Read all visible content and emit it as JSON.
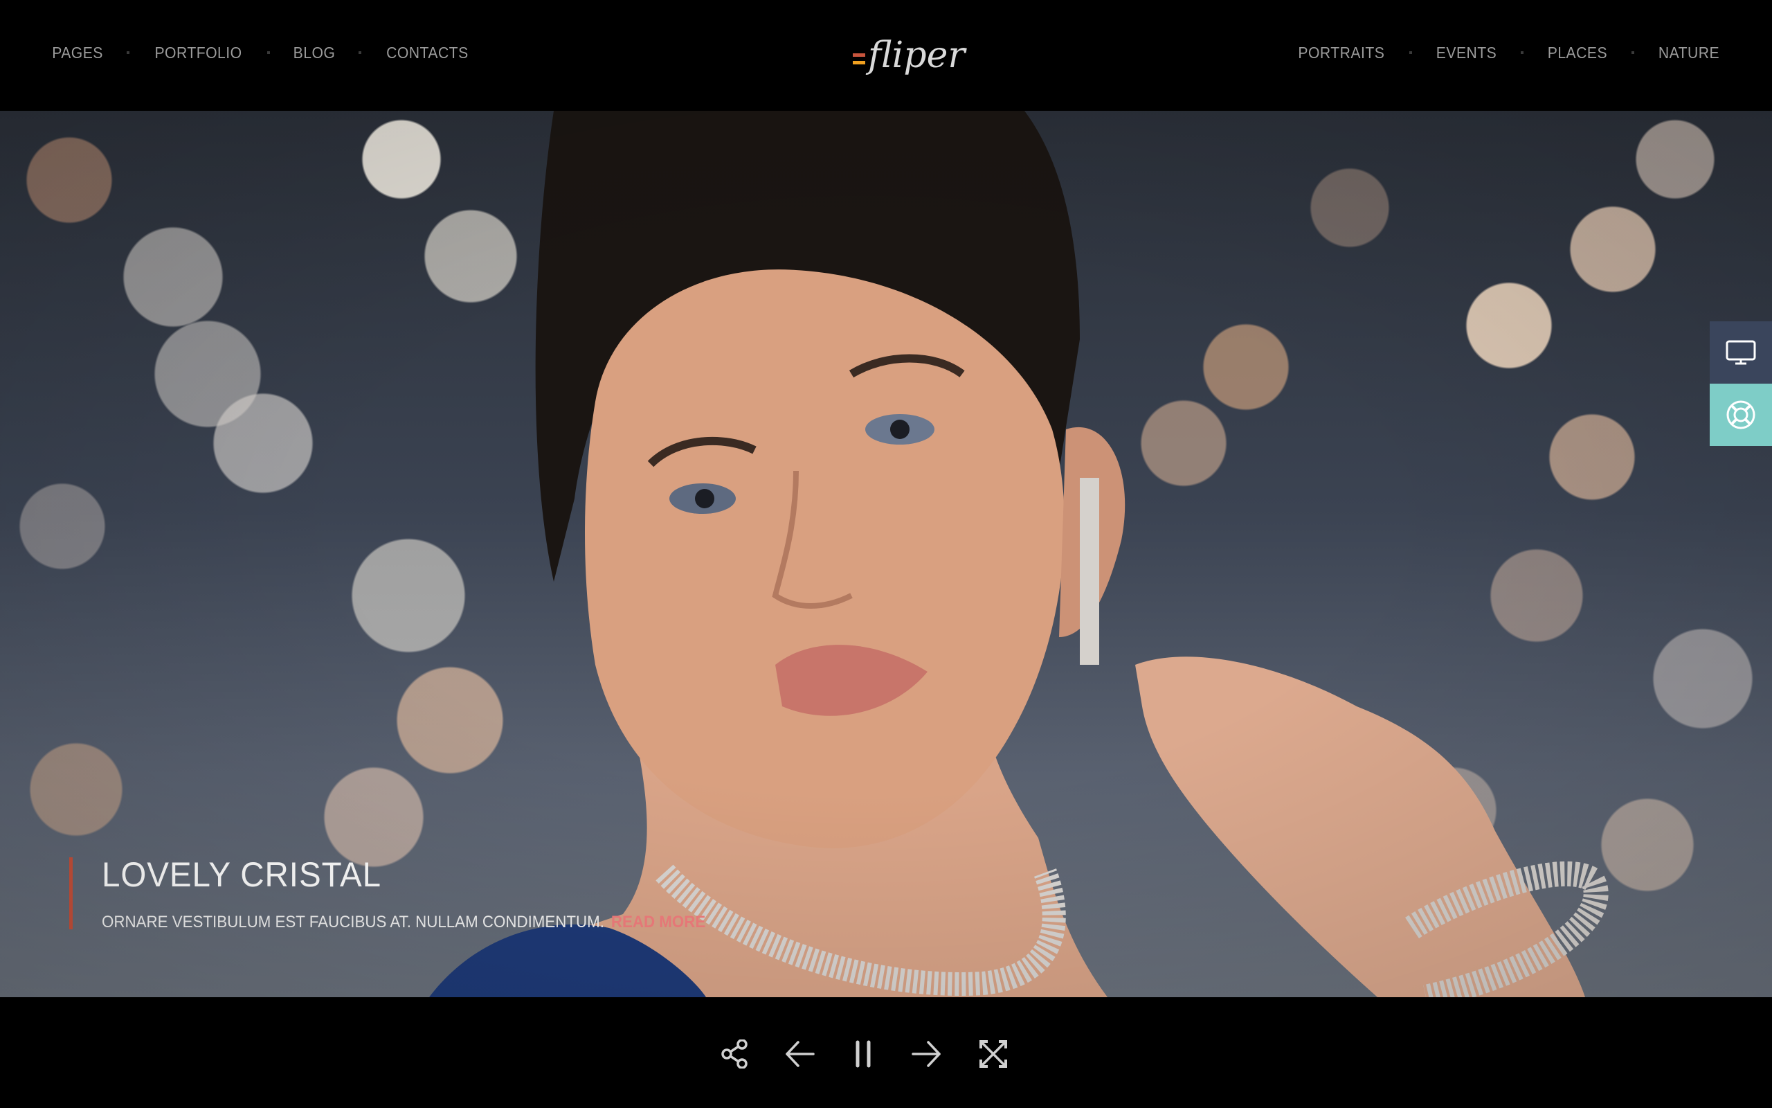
{
  "header": {
    "logo_text": "fliper",
    "logo_colors": {
      "mark_top": "#c8553d",
      "mark_bottom": "#f0a020",
      "text": "#d9d9d9"
    },
    "nav_left": [
      {
        "label": "PAGES"
      },
      {
        "label": "PORTFOLIO"
      },
      {
        "label": "BLOG"
      },
      {
        "label": "CONTACTS"
      }
    ],
    "nav_right": [
      {
        "label": "PORTRAITS"
      },
      {
        "label": "EVENTS"
      },
      {
        "label": "PLACES"
      },
      {
        "label": "NATURE"
      }
    ]
  },
  "hero": {
    "image_description": "Portrait of a woman with diamond earrings, necklace and bracelet in front of bokeh lights",
    "caption": {
      "title": "LOVELY CRISTAL",
      "text": "ORNARE VESTIBULUM EST FAUCIBUS AT. NULLAM CONDIMENTUM.",
      "link": "READ MORE",
      "accent_color": "#c7503a",
      "link_color": "#f27e7e"
    }
  },
  "side_widget": {
    "buttons": [
      {
        "icon": "monitor-icon",
        "color": "#3a455c"
      },
      {
        "icon": "lifebuoy-icon",
        "color": "#7ecdc7"
      }
    ]
  },
  "controls": {
    "buttons": [
      {
        "icon": "share-icon"
      },
      {
        "icon": "arrow-left-icon"
      },
      {
        "icon": "pause-icon"
      },
      {
        "icon": "arrow-right-icon"
      },
      {
        "icon": "fullscreen-icon"
      }
    ],
    "icon_color": "#d0d0d0"
  }
}
